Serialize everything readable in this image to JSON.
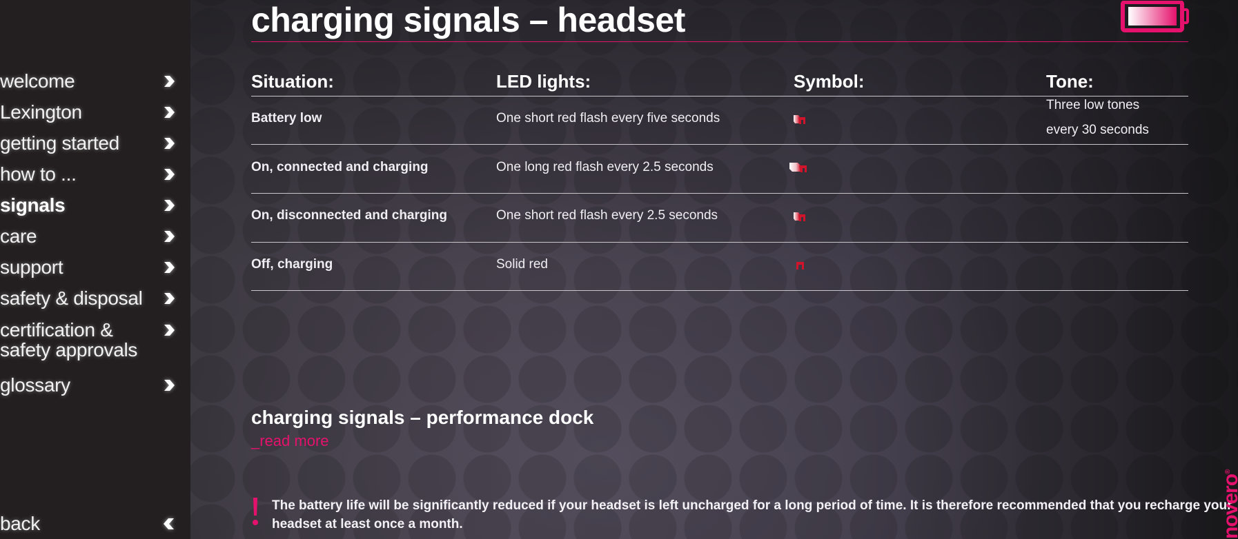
{
  "sidebar": {
    "items": [
      {
        "label": "welcome",
        "icon": "chevron-right-icon",
        "active": false
      },
      {
        "label": "Lexington",
        "icon": "chevron-right-icon",
        "active": false
      },
      {
        "label": "getting started",
        "icon": "chevron-right-icon",
        "active": false
      },
      {
        "label": "how to ...",
        "icon": "chevron-right-icon",
        "active": false
      },
      {
        "label": "signals",
        "icon": "chevron-right-icon",
        "active": true
      },
      {
        "label": "care",
        "icon": "chevron-right-icon",
        "active": false
      },
      {
        "label": "support",
        "icon": "chevron-right-icon",
        "active": false
      },
      {
        "label": "safety & disposal",
        "icon": "chevron-right-icon",
        "active": false
      },
      {
        "label": "certification &\nsafety approvals",
        "icon": "chevron-right-icon",
        "active": false
      },
      {
        "label": "glossary",
        "icon": "chevron-right-icon",
        "active": false
      }
    ],
    "back": {
      "label": "back",
      "icon": "chevron-left-icon"
    }
  },
  "header": {
    "title": "charging signals – headset",
    "icon": "battery-charging-icon"
  },
  "table": {
    "headers": {
      "situation": "Situation:",
      "led": "LED lights:",
      "symbol": "Symbol:",
      "tone": "Tone:"
    },
    "rows": [
      {
        "situation": "Battery low",
        "led": "One short red flash every five seconds",
        "symbol": "short-flash-led-icon",
        "tone_line1": "Three low tones",
        "tone_line2": "every 30 seconds"
      },
      {
        "situation": "On, connected and charging",
        "led": "One long red flash every 2.5 seconds",
        "symbol": "long-flash-led-icon",
        "tone_line1": "",
        "tone_line2": ""
      },
      {
        "situation": "On, disconnected and charging",
        "led": "One short red flash every 2.5 seconds",
        "symbol": "short-flash-led-icon",
        "tone_line1": "",
        "tone_line2": ""
      },
      {
        "situation": "Off, charging",
        "led": "Solid red",
        "symbol": "solid-led-icon",
        "tone_line1": "",
        "tone_line2": ""
      }
    ]
  },
  "related": {
    "title": "charging signals – performance dock",
    "link": "_read more"
  },
  "warning": {
    "icon": "exclamation-icon",
    "text": "The battery life will be significantly reduced if your headset is left uncharged for a long period of time. It is therefore recommended that you recharge your headset at least once a month."
  },
  "brand": {
    "logo": "novero",
    "mark": "®"
  },
  "colors": {
    "accent": "#e5126d",
    "sidebar_bg": "#231f20",
    "led_red": "#d0142c"
  }
}
